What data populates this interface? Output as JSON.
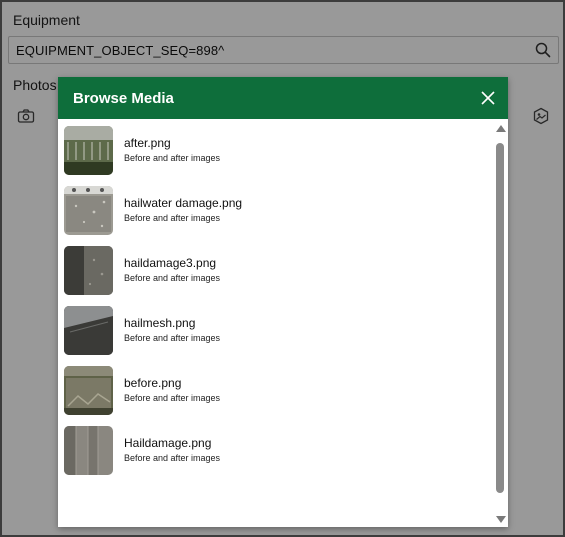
{
  "form": {
    "equipment_label": "Equipment",
    "equipment_value": "EQUIPMENT_OBJECT_SEQ=898^",
    "photos_label": "Photos"
  },
  "modal": {
    "title": "Browse Media",
    "items": [
      {
        "name": "after.png",
        "description": "Before and after images"
      },
      {
        "name": "hailwater damage.png",
        "description": "Before and after images"
      },
      {
        "name": "haildamage3.png",
        "description": "Before and after images"
      },
      {
        "name": "hailmesh.png",
        "description": "Before and after images"
      },
      {
        "name": "before.png",
        "description": "Before and after images"
      },
      {
        "name": "Haildamage.png",
        "description": "Before and after images"
      }
    ]
  },
  "colors": {
    "header": "#0e6e3b",
    "overlay": "rgba(0,0,0,0.40)"
  },
  "icons": {
    "search": "search-icon",
    "camera": "camera-icon",
    "gallery": "gallery-icon",
    "close": "close-icon"
  }
}
